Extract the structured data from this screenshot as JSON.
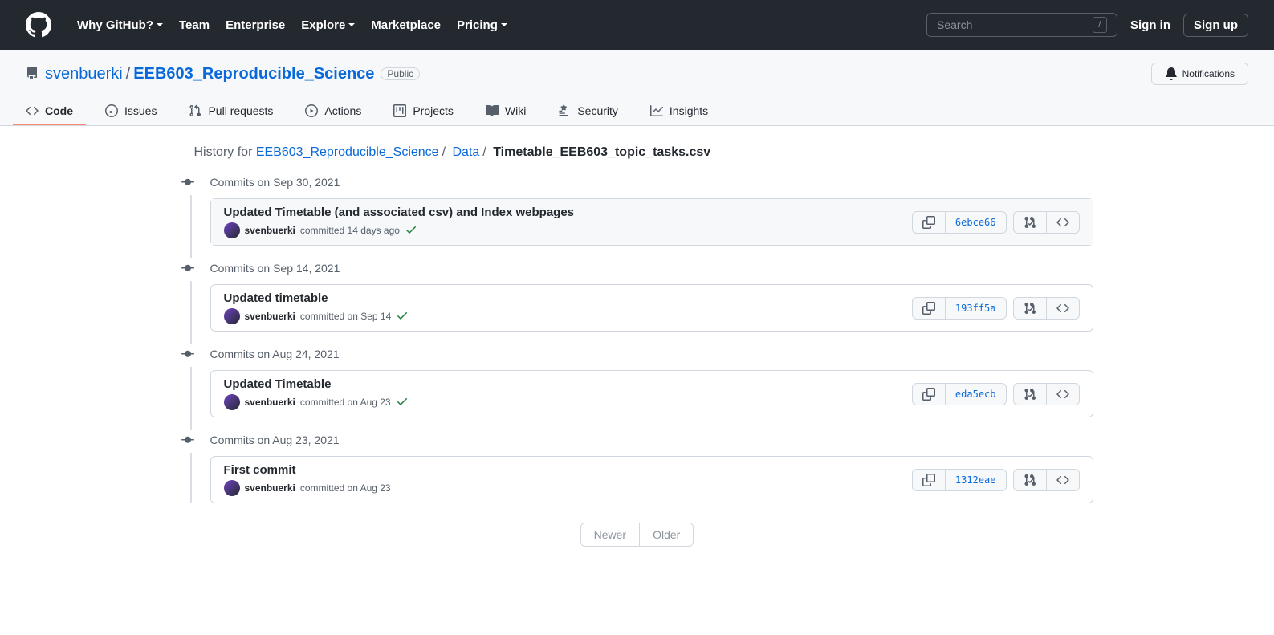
{
  "header": {
    "nav": [
      "Why GitHub?",
      "Team",
      "Enterprise",
      "Explore",
      "Marketplace",
      "Pricing"
    ],
    "nav_dropdown": [
      true,
      false,
      false,
      true,
      false,
      true
    ],
    "search_placeholder": "Search",
    "slash": "/",
    "signin": "Sign in",
    "signup": "Sign up"
  },
  "repo": {
    "owner": "svenbuerki",
    "name": "EEB603_Reproducible_Science",
    "visibility": "Public",
    "notifications": "Notifications",
    "tabs": [
      "Code",
      "Issues",
      "Pull requests",
      "Actions",
      "Projects",
      "Wiki",
      "Security",
      "Insights"
    ]
  },
  "breadcrumb": {
    "prefix": "History for",
    "parts": [
      {
        "text": "EEB603_Reproducible_Science",
        "link": true
      },
      {
        "text": "Data",
        "link": true
      },
      {
        "text": "Timetable_EEB603_topic_tasks.csv",
        "link": false
      }
    ]
  },
  "groups": [
    {
      "date": "Commits on Sep 30, 2021",
      "commits": [
        {
          "title": "Updated Timetable (and associated csv) and Index webpages",
          "author": "svenbuerki",
          "when": "committed 14 days ago",
          "check": true,
          "sha": "6ebce66",
          "hovered": true
        }
      ]
    },
    {
      "date": "Commits on Sep 14, 2021",
      "commits": [
        {
          "title": "Updated timetable",
          "author": "svenbuerki",
          "when": "committed on Sep 14",
          "check": true,
          "sha": "193ff5a",
          "hovered": false
        }
      ]
    },
    {
      "date": "Commits on Aug 24, 2021",
      "commits": [
        {
          "title": "Updated Timetable",
          "author": "svenbuerki",
          "when": "committed on Aug 23",
          "check": true,
          "sha": "eda5ecb",
          "hovered": false
        }
      ]
    },
    {
      "date": "Commits on Aug 23, 2021",
      "commits": [
        {
          "title": "First commit",
          "author": "svenbuerki",
          "when": "committed on Aug 23",
          "check": false,
          "sha": "1312eae",
          "hovered": false
        }
      ]
    }
  ],
  "pagination": {
    "newer": "Newer",
    "older": "Older"
  }
}
